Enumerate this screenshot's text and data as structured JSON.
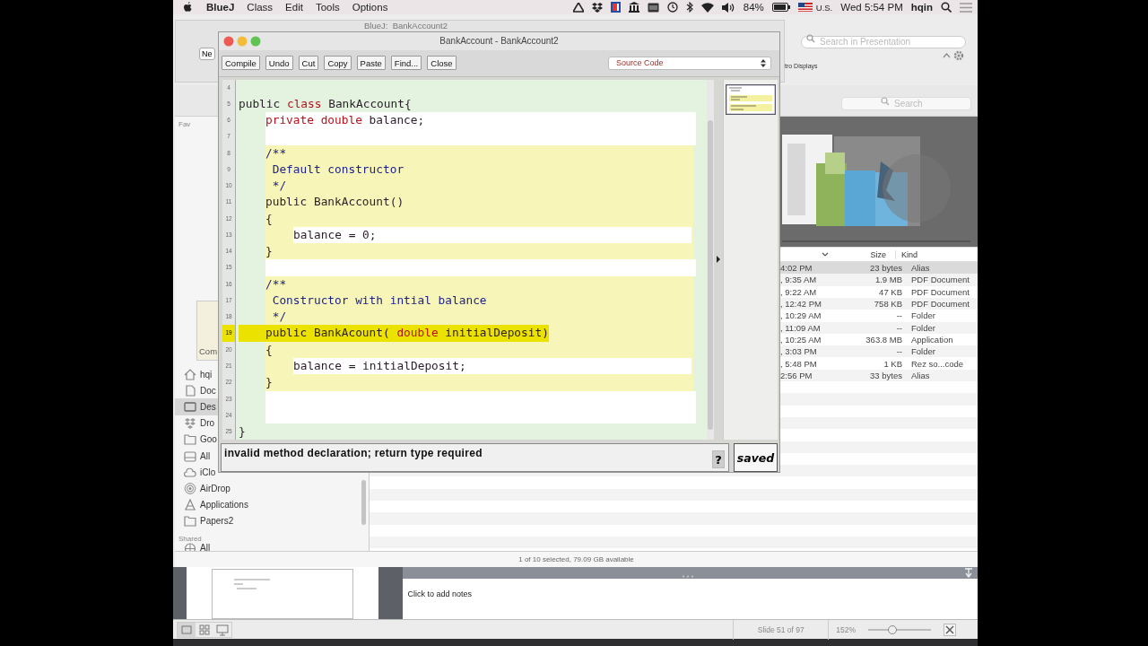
{
  "menubar": {
    "app": "BlueJ",
    "menus": [
      "Class",
      "Edit",
      "Tools",
      "Options"
    ],
    "battery": "84%",
    "input_source": "U.S.",
    "clock": "Wed 5:54 PM",
    "user": "hqin"
  },
  "bluej_main_window": {
    "title": "BlueJ:  BankAccount2"
  },
  "keynote": {
    "search": {
      "placeholder": "Search in Presentation"
    },
    "new_button": "Ne",
    "tab_label": "tro Displays",
    "notes_placeholder": "Click to add notes",
    "slide_counter": "Slide 51 of 97",
    "zoom": "152%",
    "zoom_slider": {
      "level": 0.38
    }
  },
  "finder": {
    "search": {
      "placeholder": "Search"
    },
    "sidebar_header": "Fav",
    "popover_text": "Com",
    "sidebar": [
      {
        "label": "hqi",
        "kind": "home",
        "selected": false
      },
      {
        "label": "Doc",
        "kind": "documents",
        "selected": false
      },
      {
        "label": "Des",
        "kind": "desktop",
        "selected": true
      },
      {
        "label": "Dro",
        "kind": "dropbox",
        "selected": false
      },
      {
        "label": "Goo",
        "kind": "folder",
        "selected": false
      },
      {
        "label": "All",
        "kind": "drive",
        "selected": false
      },
      {
        "label": "iClo",
        "kind": "cloud",
        "selected": false
      },
      {
        "label": "AirDrop",
        "kind": "airdrop",
        "selected": false
      },
      {
        "label": "Applications",
        "kind": "apps",
        "selected": false
      },
      {
        "label": "Papers2",
        "kind": "folder",
        "selected": false
      }
    ],
    "shared_header": "Shared",
    "shared_items": [
      {
        "label": "All",
        "kind": "network",
        "selected": false
      }
    ],
    "columns": [
      "Size",
      "Kind"
    ],
    "rows": [
      {
        "date": "4:02 PM",
        "size": "23 bytes",
        "file_type": "Alias",
        "selected": true
      },
      {
        "date": ", 9:35 AM",
        "size": "1.9 MB",
        "file_type": "PDF Document",
        "selected": false
      },
      {
        "date": ", 9:22 AM",
        "size": "47 KB",
        "file_type": "PDF Document",
        "selected": false
      },
      {
        "date": ", 12:42 PM",
        "size": "758 KB",
        "file_type": "PDF Document",
        "selected": false
      },
      {
        "date": ", 10:29 AM",
        "size": "--",
        "file_type": "Folder",
        "selected": false
      },
      {
        "date": ", 11:09 AM",
        "size": "--",
        "file_type": "Folder",
        "selected": false
      },
      {
        "date": ", 10:25 AM",
        "size": "363.8 MB",
        "file_type": "Application",
        "selected": false
      },
      {
        "date": ", 3:03 PM",
        "size": "--",
        "file_type": "Folder",
        "selected": false
      },
      {
        "date": ", 5:48 PM",
        "size": "1 KB",
        "file_type": "Rez so...code",
        "selected": false
      },
      {
        "date": "2:56 PM",
        "size": "33 bytes",
        "file_type": "Alias",
        "selected": false
      }
    ],
    "status": "1 of 10 selected, 79.09 GB available"
  },
  "editor": {
    "title": "BankAccount - BankAccount2",
    "buttons": [
      "Compile",
      "Undo",
      "Cut",
      "Copy",
      "Paste",
      "Find...",
      "Close"
    ],
    "view_selector": "Source Code",
    "lines": [
      {
        "number": "4",
        "kind": "class",
        "error": false
      },
      {
        "number": "5",
        "kind": "class",
        "error": false,
        "tokens": [
          {
            "kind": "plain",
            "text": "public "
          },
          {
            "kind": "keyword",
            "text": "class"
          },
          {
            "kind": "plain",
            "text": " BankAccount{"
          }
        ]
      },
      {
        "number": "6",
        "kind": "body",
        "error": false,
        "tokens": [
          {
            "kind": "keyword",
            "text": "private double"
          },
          {
            "kind": "plain",
            "text": " balance;"
          }
        ]
      },
      {
        "number": "7",
        "kind": "body",
        "error": false
      },
      {
        "number": "8",
        "kind": "method",
        "error": false,
        "tokens": [
          {
            "kind": "comment",
            "text": "/**"
          }
        ]
      },
      {
        "number": "9",
        "kind": "method",
        "error": false,
        "tokens": [
          {
            "kind": "comment",
            "text": " Default constructor"
          }
        ]
      },
      {
        "number": "10",
        "kind": "method",
        "error": false,
        "tokens": [
          {
            "kind": "comment",
            "text": " */"
          }
        ]
      },
      {
        "number": "11",
        "kind": "method",
        "error": false,
        "tokens": [
          {
            "kind": "plain",
            "text": "public BankAccount()"
          }
        ]
      },
      {
        "number": "12",
        "kind": "method",
        "error": false,
        "tokens": [
          {
            "kind": "plain",
            "text": "{"
          }
        ]
      },
      {
        "number": "13",
        "kind": "inner",
        "error": false,
        "tokens": [
          {
            "kind": "plain",
            "text": "balance = 0;"
          }
        ]
      },
      {
        "number": "14",
        "kind": "method",
        "error": false,
        "tokens": [
          {
            "kind": "plain",
            "text": "}"
          }
        ]
      },
      {
        "number": "15",
        "kind": "body",
        "error": false
      },
      {
        "number": "16",
        "kind": "method",
        "error": false,
        "tokens": [
          {
            "kind": "comment",
            "text": "/**"
          }
        ]
      },
      {
        "number": "17",
        "kind": "method",
        "error": false,
        "tokens": [
          {
            "kind": "comment",
            "text": " Constructor with intial balance"
          }
        ]
      },
      {
        "number": "18",
        "kind": "method",
        "error": false,
        "tokens": [
          {
            "kind": "comment",
            "text": " */"
          }
        ]
      },
      {
        "number": "19",
        "kind": "method",
        "error": true,
        "tokens": [
          {
            "kind": "plain",
            "text": "public BankAcount( "
          },
          {
            "kind": "keyword",
            "text": "double"
          },
          {
            "kind": "plain",
            "text": " initialDeposit)"
          }
        ]
      },
      {
        "number": "20",
        "kind": "method",
        "error": false,
        "tokens": [
          {
            "kind": "plain",
            "text": "{"
          }
        ]
      },
      {
        "number": "21",
        "kind": "inner",
        "error": false,
        "tokens": [
          {
            "kind": "plain",
            "text": "balance = initialDeposit;"
          }
        ]
      },
      {
        "number": "22",
        "kind": "method",
        "error": false,
        "tokens": [
          {
            "kind": "plain",
            "text": "}"
          }
        ]
      },
      {
        "number": "23",
        "kind": "body",
        "error": false
      },
      {
        "number": "24",
        "kind": "body",
        "error": false
      },
      {
        "number": "25",
        "kind": "class",
        "error": false,
        "tokens": [
          {
            "kind": "plain",
            "text": "}"
          }
        ]
      }
    ],
    "message": "invalid method declaration; return type required",
    "help_button": "?",
    "save_status": "saved"
  }
}
